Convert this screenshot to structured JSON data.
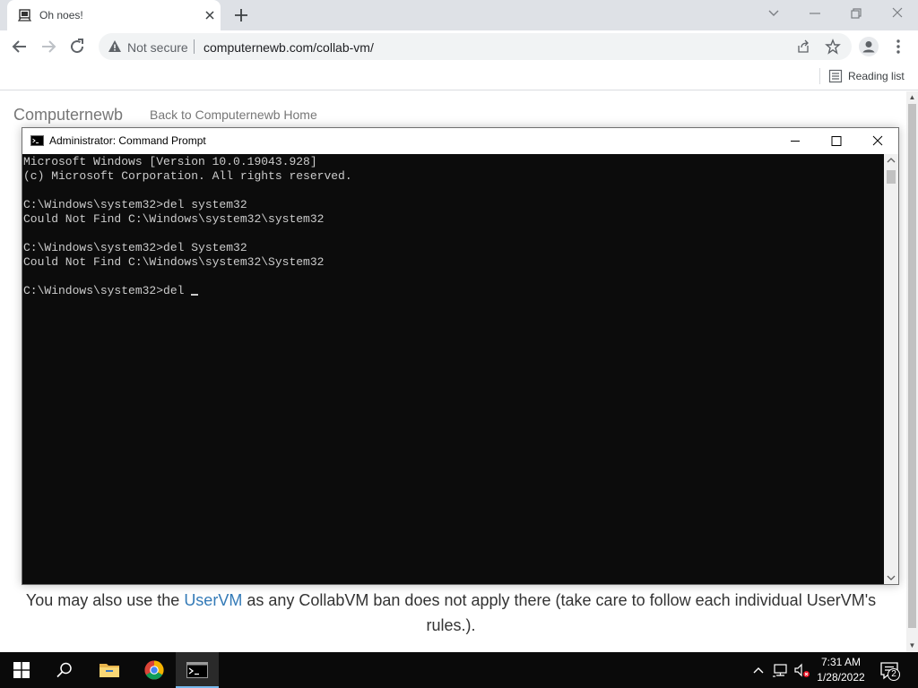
{
  "browser": {
    "tab": {
      "title": "Oh noes!"
    },
    "omnibox": {
      "security_label": "Not secure",
      "url": "computernewb.com/collab-vm/"
    },
    "bookmarks_bar": {
      "reading_list": "Reading list"
    }
  },
  "page": {
    "brand": "Computernewb",
    "back_link": "Back to Computernewb Home",
    "body_before_link": "You may also use the ",
    "body_link": "UserVM",
    "body_after_link": " as any CollabVM ban does not apply there (take care to follow each individual UserVM's rules.)."
  },
  "cmd_window": {
    "title": "Administrator: Command Prompt",
    "lines": [
      "Microsoft Windows [Version 10.0.19043.928]",
      "(c) Microsoft Corporation. All rights reserved.",
      "",
      "C:\\Windows\\system32>del system32",
      "Could Not Find C:\\Windows\\system32\\system32",
      "",
      "C:\\Windows\\system32>del System32",
      "Could Not Find C:\\Windows\\system32\\System32",
      "",
      "C:\\Windows\\system32>del "
    ]
  },
  "taskbar": {
    "apps": [
      "start-icon",
      "search-icon",
      "file-explorer-icon",
      "chrome-icon",
      "command-prompt-icon"
    ],
    "clock_time": "7:31 AM",
    "clock_date": "1/28/2022",
    "notification_count": "2"
  },
  "colors": {
    "console_bg": "#0c0c0c",
    "console_text": "#cccccc",
    "link": "#337ab7",
    "taskbar": "#0a0a0a",
    "active_app_indicator": "#76b9ed"
  }
}
